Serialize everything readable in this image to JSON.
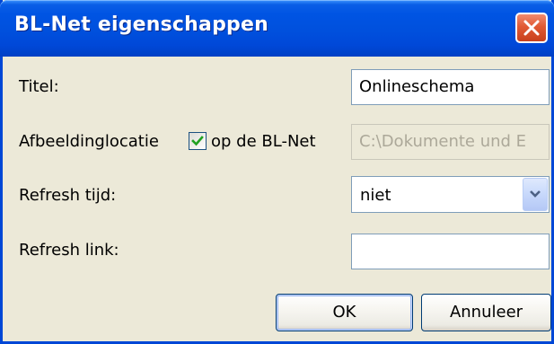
{
  "window": {
    "title": "BL-Net eigenschappen"
  },
  "form": {
    "title_label": "Titel:",
    "title_value": "Onlineschema",
    "image_location_label": "Afbeeldinglocatie",
    "on_blnet_checkbox_label": "op de BL-Net",
    "on_blnet_checked": true,
    "image_path_value": "C:\\Dokumente und E",
    "refresh_time_label": "Refresh tijd:",
    "refresh_time_selected": "niet",
    "refresh_link_label": "Refresh link:",
    "refresh_link_value": ""
  },
  "buttons": {
    "ok_label": "OK",
    "cancel_label": "Annuleer"
  },
  "icons": {
    "close": "close-icon",
    "checkmark": "checkmark-icon",
    "dropdown": "chevron-down-icon"
  },
  "colors": {
    "titlebar": "#0054e3",
    "dialog_background": "#ece9d8",
    "close_button": "#e15a34",
    "checkmark": "#21a121",
    "field_border": "#7f9db9"
  }
}
